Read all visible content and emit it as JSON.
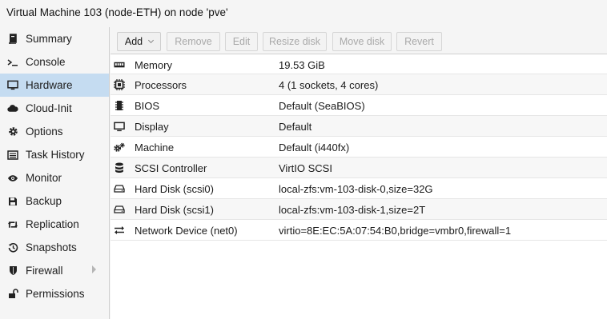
{
  "window": {
    "title": "Virtual Machine 103 (node-ETH) on node 'pve'"
  },
  "nav": {
    "items": [
      {
        "label": "Summary",
        "icon": "book-icon"
      },
      {
        "label": "Console",
        "icon": "terminal-icon"
      },
      {
        "label": "Hardware",
        "icon": "monitor-icon",
        "selected": true
      },
      {
        "label": "Cloud-Init",
        "icon": "cloud-icon"
      },
      {
        "label": "Options",
        "icon": "gear-icon"
      },
      {
        "label": "Task History",
        "icon": "list-icon"
      },
      {
        "label": "Monitor",
        "icon": "eye-icon"
      },
      {
        "label": "Backup",
        "icon": "floppy-icon"
      },
      {
        "label": "Replication",
        "icon": "retweet-icon"
      },
      {
        "label": "Snapshots",
        "icon": "history-icon"
      },
      {
        "label": "Firewall",
        "icon": "shield-icon",
        "has_submenu": true
      },
      {
        "label": "Permissions",
        "icon": "unlock-icon"
      }
    ]
  },
  "toolbar": {
    "add": "Add",
    "remove": "Remove",
    "edit": "Edit",
    "resize": "Resize disk",
    "move": "Move disk",
    "revert": "Revert"
  },
  "hardware": {
    "rows": [
      {
        "name": "Memory",
        "value": "19.53 GiB",
        "icon": "memory-icon"
      },
      {
        "name": "Processors",
        "value": "4 (1 sockets, 4 cores)",
        "icon": "cpu-icon"
      },
      {
        "name": "BIOS",
        "value": "Default (SeaBIOS)",
        "icon": "microchip-icon"
      },
      {
        "name": "Display",
        "value": "Default",
        "icon": "desktop-icon"
      },
      {
        "name": "Machine",
        "value": "Default (i440fx)",
        "icon": "cogs-icon"
      },
      {
        "name": "SCSI Controller",
        "value": "VirtIO SCSI",
        "icon": "database-icon"
      },
      {
        "name": "Hard Disk (scsi0)",
        "value": "local-zfs:vm-103-disk-0,size=32G",
        "icon": "hdd-icon"
      },
      {
        "name": "Hard Disk (scsi1)",
        "value": "local-zfs:vm-103-disk-1,size=2T",
        "icon": "hdd-icon"
      },
      {
        "name": "Network Device (net0)",
        "value": "virtio=8E:EC:5A:07:54:B0,bridge=vmbr0,firewall=1",
        "icon": "exchange-icon"
      }
    ]
  }
}
